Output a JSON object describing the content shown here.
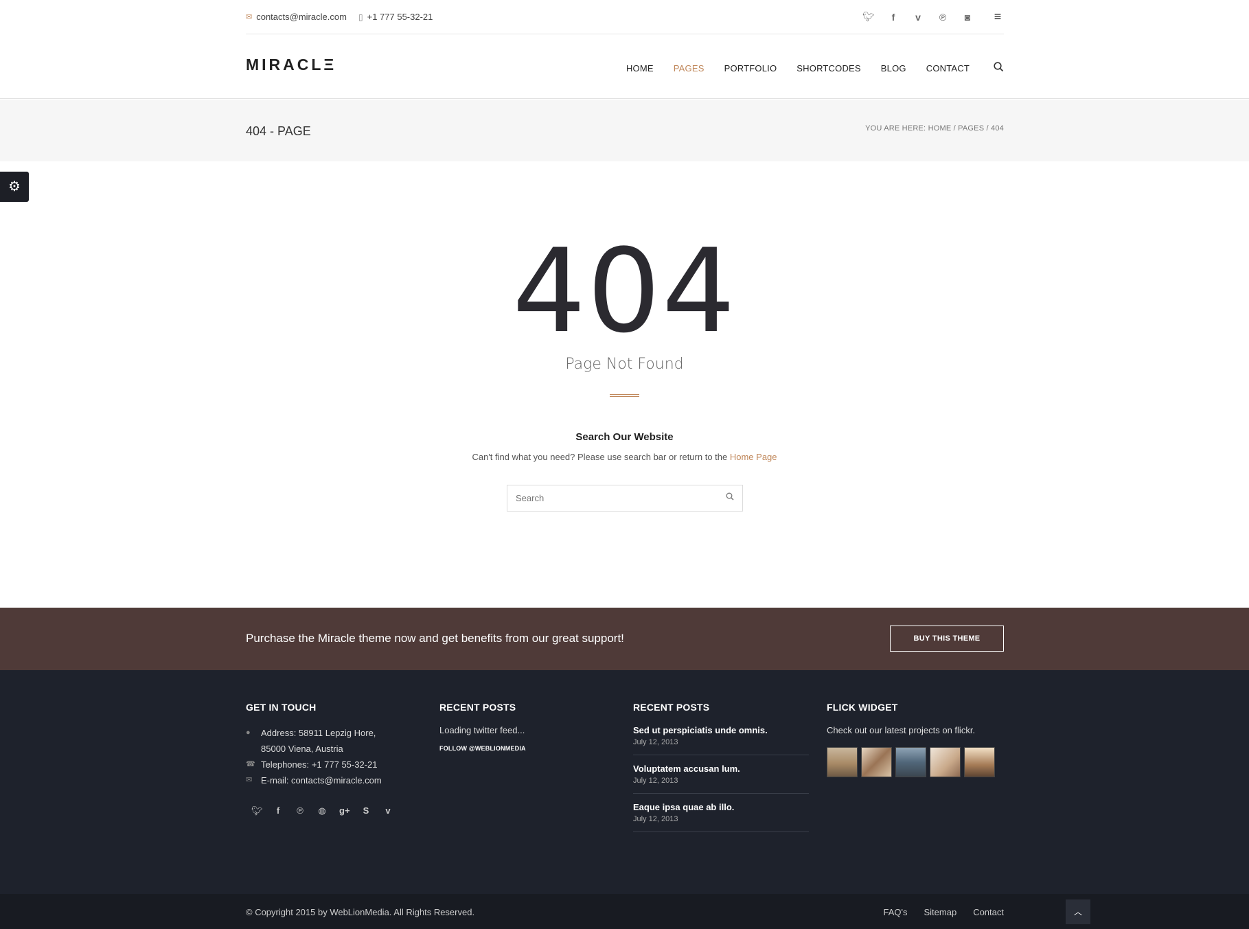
{
  "topbar": {
    "email": "contacts@miracle.com",
    "phone": "+1 777 55-32-21",
    "socials": [
      "twitter-icon",
      "facebook-icon",
      "vimeo-icon",
      "pinterest-icon",
      "instagram-icon"
    ]
  },
  "header": {
    "logo": "MIRACLΞ",
    "nav": [
      "HOME",
      "PAGES",
      "PORTFOLIO",
      "SHORTCODES",
      "BLOG",
      "CONTACT"
    ],
    "active_nav": "PAGES"
  },
  "titleband": {
    "title": "404 - PAGE",
    "breadcrumb_prefix": "YOU ARE HERE:",
    "breadcrumb": [
      "HOME",
      "PAGES",
      "404"
    ]
  },
  "error": {
    "code": "404",
    "message": "Page Not Found",
    "search_title": "Search Our Website",
    "search_desc": "Can't find what you need? Please use search bar or return to the",
    "home_link": "Home Page",
    "search_placeholder": "Search"
  },
  "purchase": {
    "text": "Purchase the Miracle theme now and get benefits from our great support!",
    "button": "BUY THIS THEME"
  },
  "footer": {
    "col1": {
      "title": "GET IN TOUCH",
      "address_1": "Address: 58911 Lepzig Hore,",
      "address_2": "85000 Viena, Austria",
      "phone": "Telephones: +1 777 55-32-21",
      "email": "E-mail: contacts@miracle.com"
    },
    "col2": {
      "title": "RECENT POSTS",
      "loading": "Loading twitter feed...",
      "follow": "FOLLOW @WEBLIONMEDIA"
    },
    "col3": {
      "title": "RECENT POSTS",
      "posts": [
        {
          "title": "Sed ut perspiciatis unde omnis.",
          "date": "July 12, 2013"
        },
        {
          "title": "Voluptatem accusan lum.",
          "date": "July 12, 2013"
        },
        {
          "title": "Eaque ipsa quae ab illo.",
          "date": "July 12, 2013"
        }
      ]
    },
    "col4": {
      "title": "FLICK WIDGET",
      "desc": "Check out our latest projects on flickr."
    }
  },
  "bottom": {
    "copyright": "© Copyright 2015 by WebLionMedia. All Rights Reserved.",
    "links": [
      "FAQ's",
      "Sitemap",
      "Contact"
    ]
  },
  "colors": {
    "accent": "#c0875a",
    "purchase_bg": "#4f3a38",
    "footer_bg": "#1e222c",
    "bottom_bg": "#181b22"
  }
}
